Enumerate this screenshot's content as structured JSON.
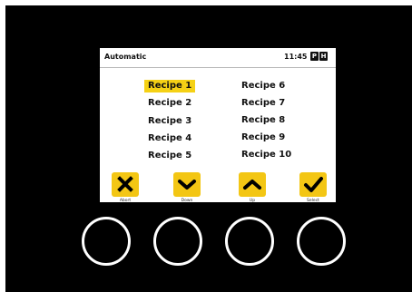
{
  "status_bar": {
    "mode": "Automatic",
    "time": "11:45",
    "indicator_p": "P",
    "indicator_h": "H"
  },
  "recipes": {
    "left": [
      "Recipe 1",
      "Recipe 2",
      "Recipe 3",
      "Recipe 4",
      "Recipe 5"
    ],
    "right": [
      "Recipe 6",
      "Recipe 7",
      "Recipe 8",
      "Recipe 9",
      "Recipe 10"
    ],
    "selected": "Recipe 1"
  },
  "softkeys": {
    "abort": {
      "label": "Abort",
      "icon": "x-icon"
    },
    "down": {
      "label": "Down",
      "icon": "chevron-down-icon"
    },
    "up": {
      "label": "Up",
      "icon": "chevron-up-icon"
    },
    "select": {
      "label": "Select",
      "icon": "checkmark-icon"
    }
  },
  "colors": {
    "accent": "#f3c614",
    "bezel": "#000000",
    "screen": "#ffffff"
  }
}
